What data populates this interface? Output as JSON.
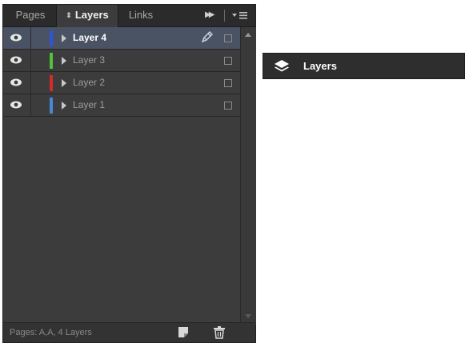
{
  "tabs": {
    "pages": "Pages",
    "layers": "Layers",
    "links": "Links",
    "layers_updown_glyph": "◇"
  },
  "toolbar": {
    "collapse_glyph": "▸▸"
  },
  "layers": [
    {
      "name": "Layer 4",
      "color": "#2f55d4",
      "selected": true
    },
    {
      "name": "Layer 3",
      "color": "#4fc33a",
      "selected": false
    },
    {
      "name": "Layer 2",
      "color": "#d42a2a",
      "selected": false
    },
    {
      "name": "Layer 1",
      "color": "#4a86d8",
      "selected": false
    }
  ],
  "footer": {
    "status": "Pages: A,A, 4 Layers"
  },
  "collapsed_panel": {
    "label": "Layers",
    "icon": "layers-stack-icon"
  },
  "colors": {
    "panel_bg": "#3c3c3c",
    "selected_row": "#4a5364",
    "collapsed_bg": "#2e2e2e"
  }
}
